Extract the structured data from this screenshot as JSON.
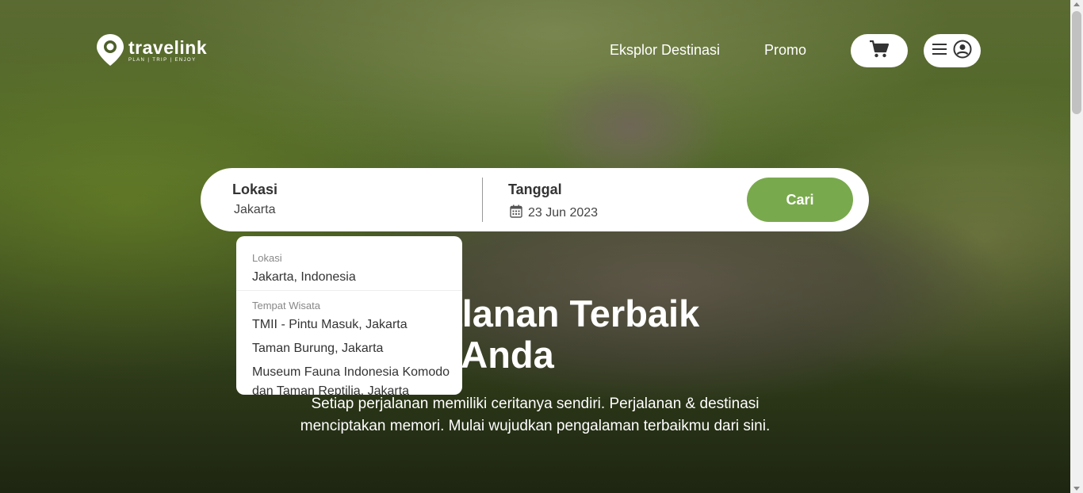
{
  "brand": {
    "name": "travelink",
    "tagline": "PLAN | TRIP | ENJOY"
  },
  "nav": {
    "eksplor": "Eksplor Destinasi",
    "promo": "Promo"
  },
  "icons": {
    "cart": "cart-icon",
    "menu": "hamburger-icon",
    "account": "user-circle-icon",
    "calendar": "calendar-icon"
  },
  "search": {
    "lokasi_label": "Lokasi",
    "lokasi_value": "Jakarta",
    "tanggal_label": "Tanggal",
    "tanggal_value": "23 Jun 2023",
    "submit_label": "Cari"
  },
  "hero": {
    "headline_line1": "Perjalanan Terbaik",
    "headline_line2": "Anda",
    "subtitle": "Setiap perjalanan memiliki ceritanya sendiri. Perjalanan & destinasi menciptakan memori. Mulai wujudkan pengalaman terbaikmu dari sini."
  },
  "dropdown": {
    "section_lokasi": "Lokasi",
    "lokasi_items": [
      "Jakarta, Indonesia"
    ],
    "section_wisata": "Tempat Wisata",
    "wisata_items": [
      "TMII - Pintu Masuk, Jakarta",
      "Taman Burung, Jakarta",
      "Museum Fauna Indonesia Komodo dan Taman Reptilia, Jakarta"
    ]
  },
  "colors": {
    "accent": "#79a94d",
    "white": "#ffffff",
    "text_dark": "#333333"
  }
}
